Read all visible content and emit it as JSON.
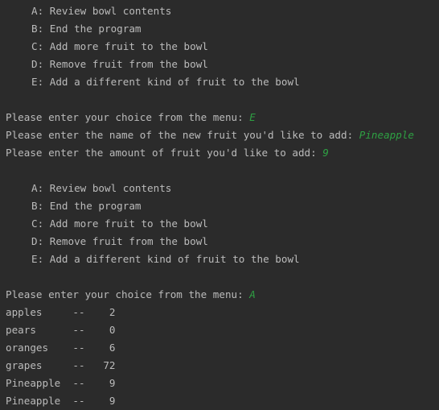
{
  "menu": [
    "A: Review bowl contents",
    "B: End the program",
    "C: Add more fruit to the bowl",
    "D: Remove fruit from the bowl",
    "E: Add a different kind of fruit to the bowl"
  ],
  "session1": {
    "choice_prompt": "Please enter your choice from the menu: ",
    "choice_input": "E",
    "name_prompt": "Please enter the name of the new fruit you'd like to add: ",
    "name_input": "Pineapple",
    "amount_prompt": "Please enter the amount of fruit you'd like to add: ",
    "amount_input": "9"
  },
  "session2": {
    "choice_prompt": "Please enter your choice from the menu: ",
    "choice_input": "A"
  },
  "bowl_rows": [
    "apples     --    2",
    "pears      --    0",
    "oranges    --    6",
    "grapes     --   72",
    "Pineapple  --    9",
    "Pineapple  --    9"
  ]
}
